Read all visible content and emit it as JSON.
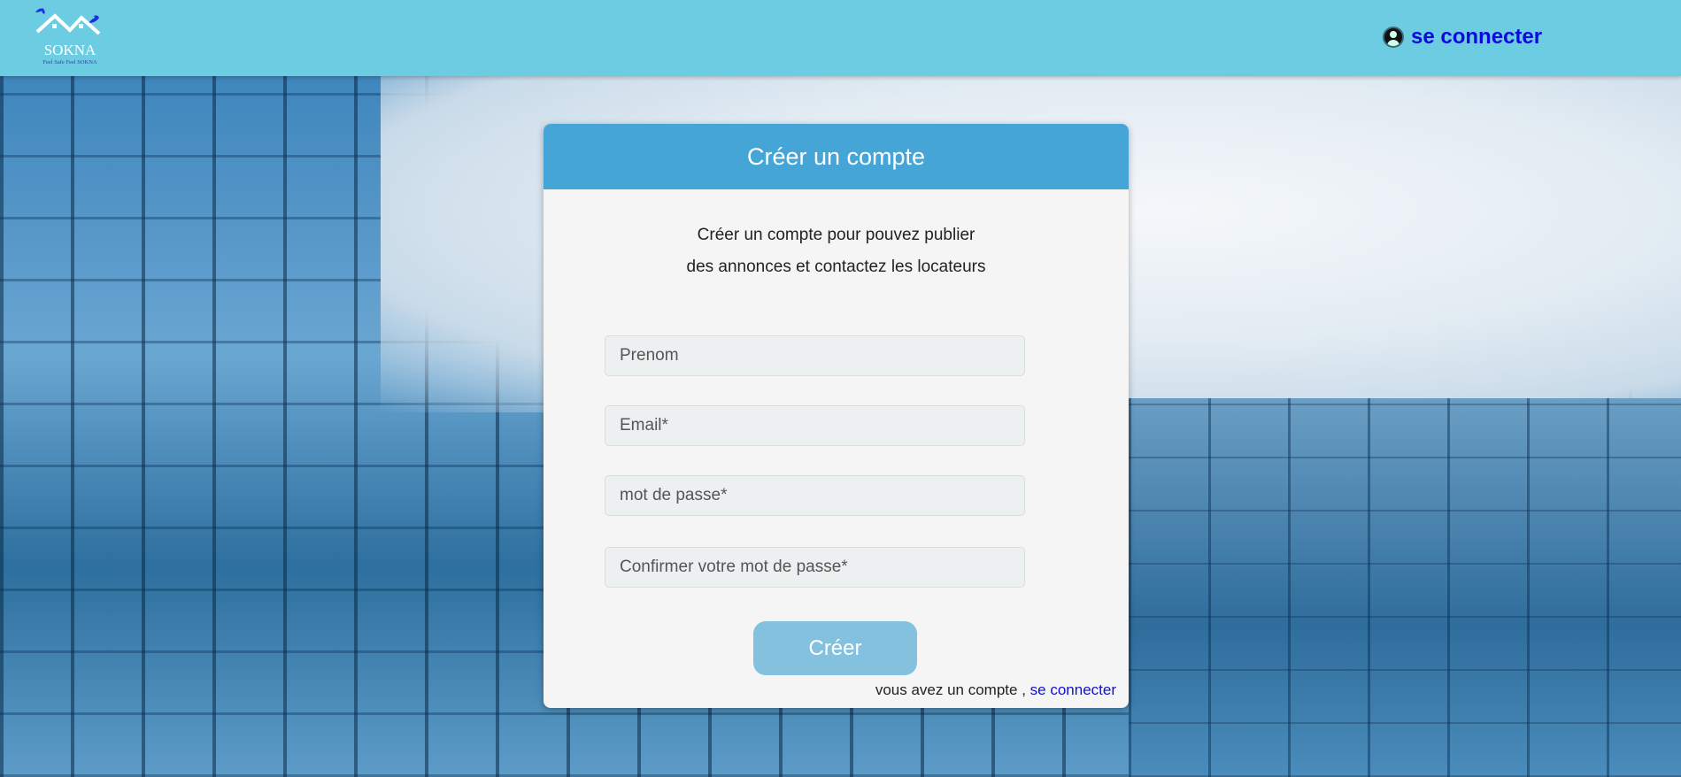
{
  "header": {
    "logo": {
      "name": "SOKNA",
      "tagline": "Feel Safe Feel SOKNA"
    },
    "login_label": "se connecter",
    "login_icon": "user-circle-icon"
  },
  "form": {
    "title": "Créer un compte",
    "subtitle_line1": "Créer un compte pour pouvez publier",
    "subtitle_line2": "des annonces et contactez les locateurs",
    "fields": [
      {
        "placeholder": "Prenom",
        "value": ""
      },
      {
        "placeholder": "Email*",
        "value": ""
      },
      {
        "placeholder": "mot de passe*",
        "value": ""
      },
      {
        "placeholder": "Confirmer votre mot de passe*",
        "value": ""
      }
    ],
    "submit_label": "Créer",
    "footer_text": "vous avez un compte ,",
    "footer_link": "se connecter"
  },
  "colors": {
    "header": "#6ccde2",
    "card_header": "#44a5d6",
    "button": "#84c1df",
    "link": "#0a0ae0"
  }
}
